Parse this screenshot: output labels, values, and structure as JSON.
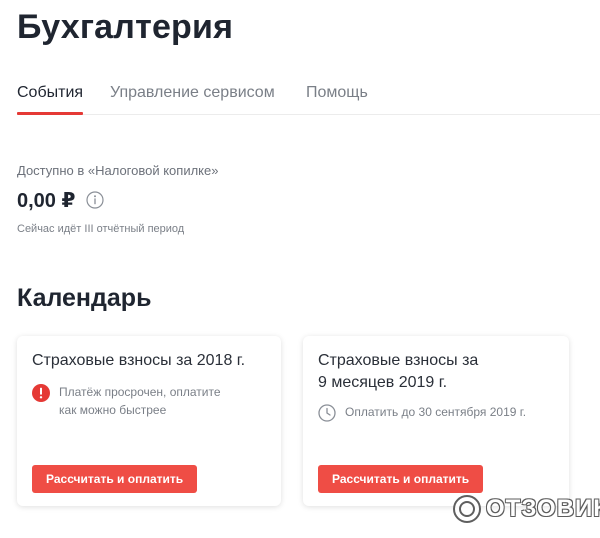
{
  "header": {
    "title": "Бухгалтерия"
  },
  "tabs": [
    {
      "label": "События",
      "active": true
    },
    {
      "label": "Управление сервисом",
      "active": false
    },
    {
      "label": "Помощь",
      "active": false
    }
  ],
  "kopilka": {
    "label": "Доступно в «Налоговой копилке»",
    "amount": "0,00 ₽",
    "period_note": "Сейчас идёт III отчётный период"
  },
  "calendar": {
    "title": "Календарь",
    "cards": [
      {
        "title": "Страховые взносы за 2018 г.",
        "status_icon": "alert-circle-icon",
        "status_text": "Платёж просрочен, оплатите как можно быстрее",
        "button_label": "Рассчитать и оплатить"
      },
      {
        "title": "Страховые взносы за 9 месяцев 2019 г.",
        "status_icon": "clock-icon",
        "status_text": "Оплатить до 30 сентября 2019 г.",
        "button_label": "Рассчитать и оплатить"
      }
    ]
  },
  "watermark": {
    "text": "ОТЗОВИК"
  },
  "colors": {
    "accent": "#e53935",
    "button": "#ef4d45",
    "title": "#1f2530",
    "muted": "#7a7f87"
  }
}
